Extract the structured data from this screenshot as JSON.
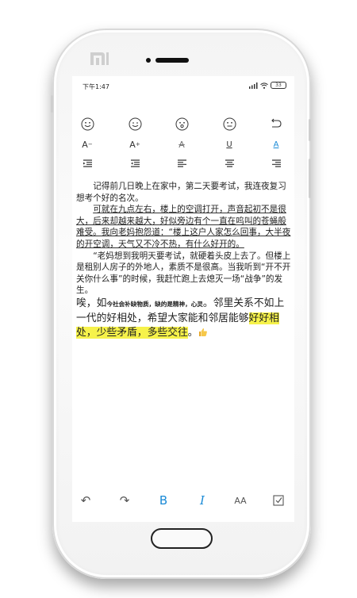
{
  "status_bar": {
    "time": "下午1:47",
    "battery": "33"
  },
  "toolbar": {
    "emoji": [
      "smile-icon",
      "grin-icon",
      "surprised-icon",
      "neutral-icon"
    ],
    "font_small": "A",
    "font_large": "A",
    "strike": "A",
    "underline": "U",
    "color": "A"
  },
  "note": {
    "p1": "记得前几日晚上在家中，第二天要考试，我连夜复习想考个好的名次。",
    "p2": "可就在九点左右，楼上的空调打开，声音起初不是很大，后来却越来越大，好似旁边有个一直在呜叫的苍蝇般难受。我向老妈抱怨道：“楼上这户人家怎么回事，大半夜的开空调，天气又不冷不热，有什么好开的。",
    "p3": "“老妈想到我明天要考试，就硬着头皮上去了。但楼上是租别人房子的外地人，素质不是很高。当我听到“开不开关你什么事”的时候，我赶忙跑上去熄灭一场“战争”的发生。",
    "p4_a": "唉，如",
    "p4_b": "今社会补缺物质，缺的是精神，心灵",
    "p4_c": "。邻里关系不如上一代的好相处，希望大家能和邻居能够",
    "p4_hl": "好好相处，少些矛盾，多些交往",
    "p4_end": "。"
  },
  "bottom_bar": {
    "undo": "↶",
    "redo": "↷",
    "bold": "B",
    "italic": "I",
    "size": "AA"
  },
  "colors": {
    "accent": "#1a8ad6",
    "highlight": "#f6f24a"
  }
}
